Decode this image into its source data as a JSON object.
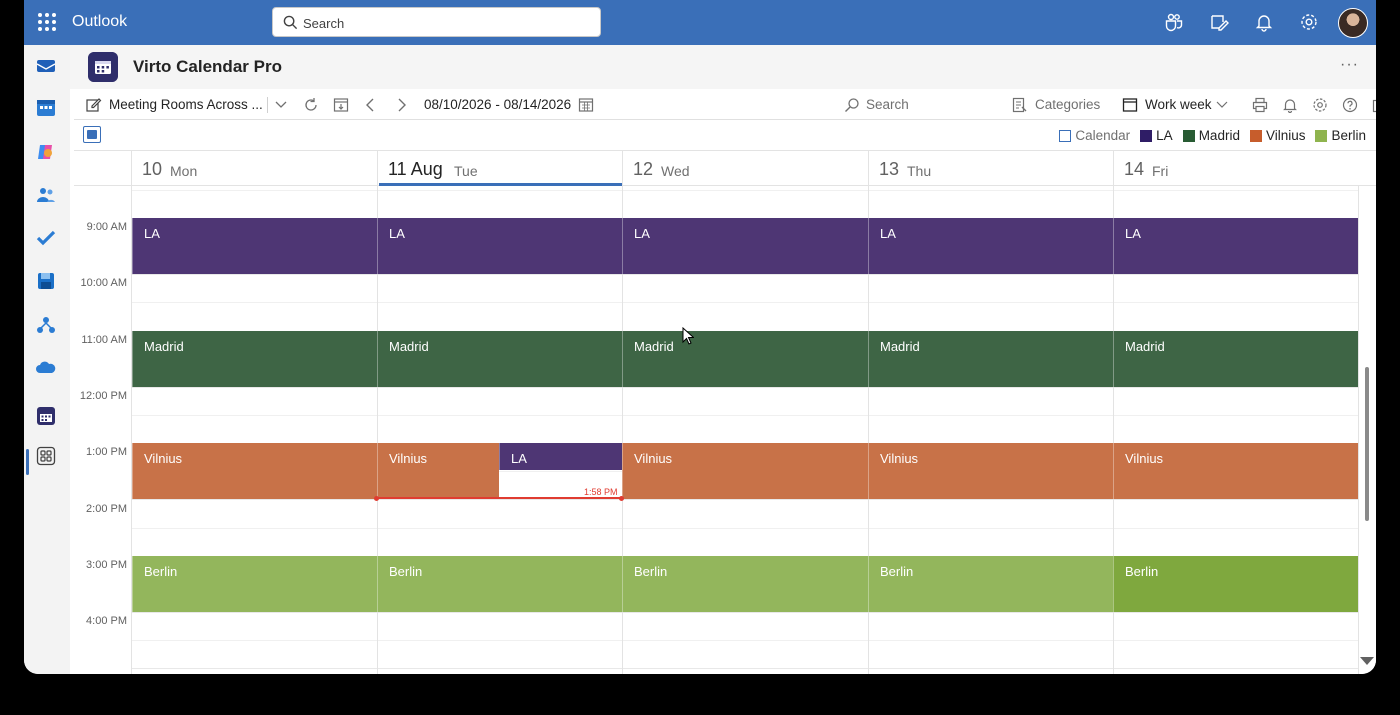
{
  "topbar": {
    "app_name": "Outlook",
    "search_placeholder": "Search",
    "icons": [
      "waffle-icon",
      "teams-icon",
      "compose-note-icon",
      "bell-icon",
      "gear-icon"
    ]
  },
  "rail": {
    "icons": [
      "mail-icon",
      "calendar-icon",
      "copilot-icon",
      "people-icon",
      "todo-icon",
      "save-icon",
      "org-icon",
      "onedrive-icon",
      "virto-calendar-icon",
      "apps-icon"
    ],
    "active": "virto-calendar-icon"
  },
  "app": {
    "title": "Virto Calendar Pro",
    "more_label": "···"
  },
  "toolbar": {
    "calendar_name": "Meeting Rooms Across ...",
    "date_range": "08/10/2026 - 08/14/2026",
    "search_placeholder": "Search",
    "categories_label": "Categories",
    "view_label": "Work week"
  },
  "legend": [
    {
      "label": "Calendar",
      "color": "#ffffff",
      "outline": "#3a6fb8"
    },
    {
      "label": "LA",
      "color": "#2f1d66"
    },
    {
      "label": "Madrid",
      "color": "#285b33"
    },
    {
      "label": "Vilnius",
      "color": "#c75d2c"
    },
    {
      "label": "Berlin",
      "color": "#8fb44e"
    }
  ],
  "days": [
    {
      "num": "10",
      "name": "Mon",
      "today": false
    },
    {
      "num": "11 Aug",
      "name": "Tue",
      "today": true
    },
    {
      "num": "12",
      "name": "Wed",
      "today": false
    },
    {
      "num": "13",
      "name": "Thu",
      "today": false
    },
    {
      "num": "14",
      "name": "Fri",
      "today": false
    }
  ],
  "times": [
    "9:00 AM",
    "10:00 AM",
    "11:00 AM",
    "12:00 PM",
    "1:00 PM",
    "2:00 PM",
    "3:00 PM",
    "4:00 PM"
  ],
  "events": {
    "la": {
      "label": "LA",
      "color": "#4e3674"
    },
    "madrid": {
      "label": "Madrid",
      "color": "#3e6545"
    },
    "vilnius": {
      "label": "Vilnius",
      "color": "#c87248"
    },
    "berlin": {
      "label": "Berlin",
      "color": "#93b65c"
    },
    "berlin_fri_color": "#7fa83e",
    "extra_la_tue": "LA"
  },
  "now_label": "1:58 PM"
}
